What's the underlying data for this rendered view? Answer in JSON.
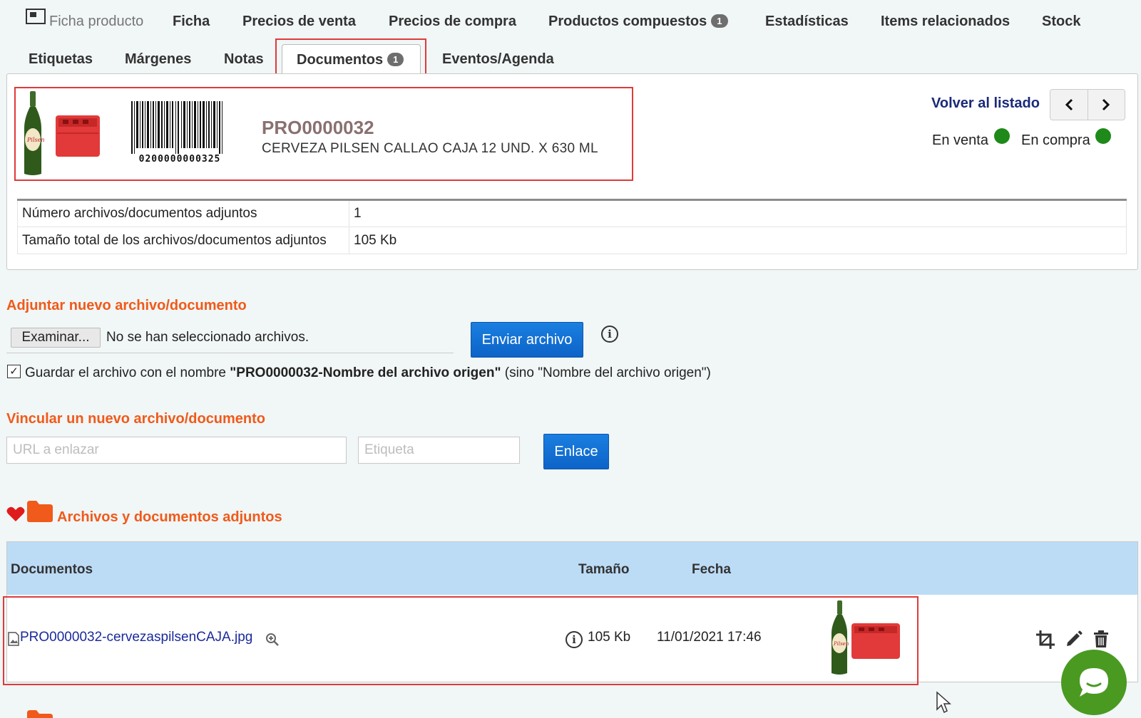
{
  "tabs_row1": [
    {
      "label": "Ficha producto",
      "muted": true
    },
    {
      "label": "Ficha"
    },
    {
      "label": "Precios de venta"
    },
    {
      "label": "Precios de compra"
    },
    {
      "label": "Productos compuestos",
      "badge": "1"
    },
    {
      "label": "Estadísticas"
    },
    {
      "label": "Items relacionados"
    },
    {
      "label": "Stock"
    }
  ],
  "tabs_row2": [
    {
      "label": "Etiquetas"
    },
    {
      "label": "Márgenes"
    },
    {
      "label": "Notas"
    },
    {
      "label": "Documentos",
      "badge": "1",
      "active": true
    },
    {
      "label": "Eventos/Agenda"
    }
  ],
  "product": {
    "code": "PRO0000032",
    "name": "CERVEZA PILSEN CALLAO CAJA 12 UND. X 630 ML",
    "barcode_text": "0200000000325",
    "image_icon": "beer-bottle-and-crate-image",
    "back_label": "Volver al listado",
    "in_sale_label": "En venta",
    "in_purchase_label": "En compra",
    "status_color": "#1f8a1a"
  },
  "summary": [
    {
      "label": "Número archivos/documentos adjuntos",
      "value": "1"
    },
    {
      "label": "Tamaño total de los archivos/documentos adjuntos",
      "value": "105 Kb"
    }
  ],
  "attach": {
    "title": "Adjuntar nuevo archivo/documento",
    "browse_label": "Examinar...",
    "file_status": "No se han seleccionado archivos.",
    "send_label": "Enviar archivo",
    "checkbox_checked": true,
    "checkbox_prefix": "Guardar el archivo con el nombre ",
    "checkbox_bold": "\"PRO0000032-Nombre del archivo origen\"",
    "checkbox_suffix": " (sino \"Nombre del archivo origen\")"
  },
  "link_section": {
    "title": "Vincular un nuevo archivo/documento",
    "url_placeholder": "URL a enlazar",
    "label_placeholder": "Etiqueta",
    "link_button": "Enlace"
  },
  "attachments": {
    "title": "Archivos y documentos adjuntos",
    "columns": {
      "documents": "Documentos",
      "size": "Tamaño",
      "date": "Fecha"
    },
    "rows": [
      {
        "filename": "PRO0000032-cervezaspilsenCAJA.jpg",
        "size": "105 Kb",
        "date": "11/01/2021 17:46"
      }
    ]
  },
  "colors": {
    "accent": "#f05a1a",
    "primary_button": "#0d63c8",
    "table_header": "#bcdcf6",
    "chat": "#4a9a22"
  }
}
